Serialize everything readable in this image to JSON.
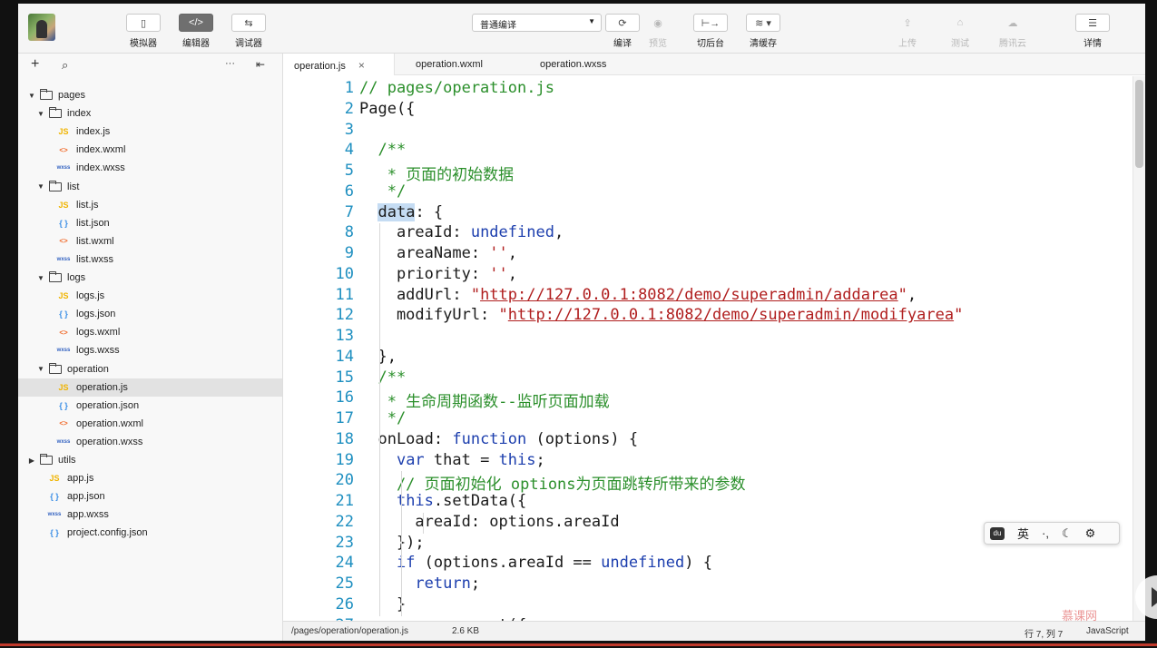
{
  "toolbar": {
    "left_buttons": [
      {
        "label": "模拟器",
        "icon": "phone-icon",
        "glyph": "▯",
        "active": false
      },
      {
        "label": "编辑器",
        "icon": "code-icon",
        "glyph": "</>",
        "active": true
      },
      {
        "label": "调试器",
        "icon": "debug-icon",
        "glyph": "⇆",
        "active": false
      }
    ],
    "compile_mode": "普通编译",
    "center_buttons": [
      {
        "label": "编译",
        "icon": "refresh-icon",
        "glyph": "⟳",
        "disabled": false
      },
      {
        "label": "预览",
        "icon": "eye-icon",
        "glyph": "◉",
        "disabled": true
      },
      {
        "label": "切后台",
        "icon": "switch-background-icon",
        "glyph": "⊢→",
        "disabled": false
      },
      {
        "label": "清缓存",
        "icon": "layers-icon",
        "glyph": "≋ ▾",
        "disabled": false
      }
    ],
    "right_buttons": [
      {
        "label": "上传",
        "icon": "upload-icon",
        "glyph": "⇪",
        "disabled": true
      },
      {
        "label": "测试",
        "icon": "test-icon",
        "glyph": "⌂",
        "disabled": true
      },
      {
        "label": "腾讯云",
        "icon": "cloud-icon",
        "glyph": "☁",
        "disabled": true
      },
      {
        "label": "详情",
        "icon": "menu-icon",
        "glyph": "☰",
        "disabled": false
      }
    ]
  },
  "sidebar": {
    "tree": [
      {
        "name": "pages",
        "kind": "folder",
        "depth": 0,
        "expanded": true
      },
      {
        "name": "index",
        "kind": "folder",
        "depth": 1,
        "expanded": true
      },
      {
        "name": "index.js",
        "kind": "js",
        "depth": 2
      },
      {
        "name": "index.wxml",
        "kind": "wxml",
        "depth": 2
      },
      {
        "name": "index.wxss",
        "kind": "wxss",
        "depth": 2
      },
      {
        "name": "list",
        "kind": "folder",
        "depth": 1,
        "expanded": true
      },
      {
        "name": "list.js",
        "kind": "js",
        "depth": 2
      },
      {
        "name": "list.json",
        "kind": "json",
        "depth": 2
      },
      {
        "name": "list.wxml",
        "kind": "wxml",
        "depth": 2
      },
      {
        "name": "list.wxss",
        "kind": "wxss",
        "depth": 2
      },
      {
        "name": "logs",
        "kind": "folder",
        "depth": 1,
        "expanded": true
      },
      {
        "name": "logs.js",
        "kind": "js",
        "depth": 2
      },
      {
        "name": "logs.json",
        "kind": "json",
        "depth": 2
      },
      {
        "name": "logs.wxml",
        "kind": "wxml",
        "depth": 2
      },
      {
        "name": "logs.wxss",
        "kind": "wxss",
        "depth": 2
      },
      {
        "name": "operation",
        "kind": "folder",
        "depth": 1,
        "expanded": true
      },
      {
        "name": "operation.js",
        "kind": "js",
        "depth": 2,
        "selected": true
      },
      {
        "name": "operation.json",
        "kind": "json",
        "depth": 2
      },
      {
        "name": "operation.wxml",
        "kind": "wxml",
        "depth": 2
      },
      {
        "name": "operation.wxss",
        "kind": "wxss",
        "depth": 2
      },
      {
        "name": "utils",
        "kind": "folder",
        "depth": 0,
        "expanded": false
      },
      {
        "name": "app.js",
        "kind": "js",
        "depth": 1
      },
      {
        "name": "app.json",
        "kind": "json",
        "depth": 1
      },
      {
        "name": "app.wxss",
        "kind": "wxss",
        "depth": 1
      },
      {
        "name": "project.config.json",
        "kind": "json",
        "depth": 1
      }
    ],
    "file_type_badges": {
      "js": "JS",
      "json": "{ }",
      "wxml": "<>",
      "wxss": "wxss"
    }
  },
  "tabs": [
    {
      "label": "operation.js",
      "active": true,
      "close": "×"
    },
    {
      "label": "operation.wxml",
      "active": false
    },
    {
      "label": "operation.wxss",
      "active": false
    }
  ],
  "code_lines": [
    [
      {
        "t": "// pages/operation.js",
        "c": "cm"
      }
    ],
    [
      {
        "t": "Page({",
        "c": ""
      }
    ],
    [],
    [
      {
        "t": "  /**",
        "c": "cm"
      }
    ],
    [
      {
        "t": "   * 页面的初始数据",
        "c": "cm"
      }
    ],
    [
      {
        "t": "   */",
        "c": "cm"
      }
    ],
    [
      {
        "t": "  ",
        "c": ""
      },
      {
        "t": "data",
        "c": "hl"
      },
      {
        "t": ": {",
        "c": ""
      }
    ],
    [
      {
        "t": "    areaId: ",
        "c": ""
      },
      {
        "t": "undefined",
        "c": "kw"
      },
      {
        "t": ",",
        "c": ""
      }
    ],
    [
      {
        "t": "    areaName: ",
        "c": ""
      },
      {
        "t": "''",
        "c": "str"
      },
      {
        "t": ",",
        "c": ""
      }
    ],
    [
      {
        "t": "    priority: ",
        "c": ""
      },
      {
        "t": "''",
        "c": "str"
      },
      {
        "t": ",",
        "c": ""
      }
    ],
    [
      {
        "t": "    addUrl: ",
        "c": ""
      },
      {
        "t": "\"",
        "c": "str"
      },
      {
        "t": "http://127.0.0.1:8082/demo/superadmin/addarea",
        "c": "url"
      },
      {
        "t": "\"",
        "c": "str"
      },
      {
        "t": ",",
        "c": ""
      }
    ],
    [
      {
        "t": "    modifyUrl: ",
        "c": ""
      },
      {
        "t": "\"",
        "c": "str"
      },
      {
        "t": "http://127.0.0.1:8082/demo/superadmin/modifyarea",
        "c": "url"
      },
      {
        "t": "\"",
        "c": "str"
      }
    ],
    [],
    [
      {
        "t": "  },",
        "c": ""
      }
    ],
    [
      {
        "t": "  /**",
        "c": "cm"
      }
    ],
    [
      {
        "t": "   * 生命周期函数--监听页面加载",
        "c": "cm"
      }
    ],
    [
      {
        "t": "   */",
        "c": "cm"
      }
    ],
    [
      {
        "t": "  onLoad: ",
        "c": ""
      },
      {
        "t": "function",
        "c": "kw"
      },
      {
        "t": " (options) {",
        "c": ""
      }
    ],
    [
      {
        "t": "    ",
        "c": ""
      },
      {
        "t": "var",
        "c": "kw"
      },
      {
        "t": " that = ",
        "c": ""
      },
      {
        "t": "this",
        "c": "kw"
      },
      {
        "t": ";",
        "c": ""
      }
    ],
    [
      {
        "t": "    // 页面初始化 options为页面跳转所带来的参数",
        "c": "cm"
      }
    ],
    [
      {
        "t": "    ",
        "c": ""
      },
      {
        "t": "this",
        "c": "kw"
      },
      {
        "t": ".setData({",
        "c": ""
      }
    ],
    [
      {
        "t": "      areaId: options.areaId",
        "c": ""
      }
    ],
    [
      {
        "t": "    });",
        "c": ""
      }
    ],
    [
      {
        "t": "    ",
        "c": ""
      },
      {
        "t": "if",
        "c": "kw"
      },
      {
        "t": " (options.areaId == ",
        "c": ""
      },
      {
        "t": "undefined",
        "c": "kw"
      },
      {
        "t": ") {",
        "c": ""
      }
    ],
    [
      {
        "t": "      ",
        "c": ""
      },
      {
        "t": "return",
        "c": "kw"
      },
      {
        "t": ";",
        "c": ""
      }
    ],
    [
      {
        "t": "    }",
        "c": ""
      }
    ],
    [
      {
        "t": "      wx.request({",
        "c": ""
      }
    ]
  ],
  "status": {
    "path": "/pages/operation/operation.js",
    "size": "2.6 KB",
    "cursor": "行 7, 列 7",
    "language": "JavaScript"
  },
  "ime": {
    "logo": "du",
    "lang": "英",
    "punct": "·,",
    "moon": "☾",
    "gear": "⚙"
  },
  "watermark": "慕课网"
}
